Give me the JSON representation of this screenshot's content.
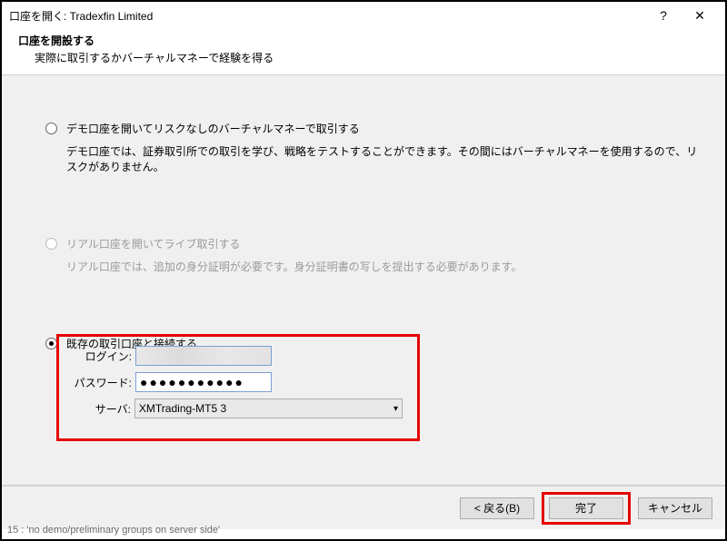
{
  "titlebar": {
    "title": "口座を開く: Tradexfin Limited",
    "help": "?",
    "close": "✕"
  },
  "subheader": {
    "title": "口座を開設する",
    "desc": "実際に取引するかバーチャルマネーで経験を得る"
  },
  "options": {
    "demo": {
      "title": "デモ口座を開いてリスクなしのバーチャルマネーで取引する",
      "desc": "デモ口座では、証券取引所での取引を学び、戦略をテストすることができます。その間にはバーチャルマネーを使用するので、リスクがありません。"
    },
    "real": {
      "title": "リアル口座を開いてライブ取引する",
      "desc": "リアル口座では、追加の身分証明が必要です。身分証明書の写しを提出する必要があります。"
    },
    "existing": {
      "title": "既存の取引口座と接続する"
    }
  },
  "form": {
    "login_label": "ログイン:",
    "login_value": "",
    "password_label": "パスワード:",
    "password_mask": "●●●●●●●●●●●",
    "server_label": "サーバ:",
    "server_value": "XMTrading-MT5 3"
  },
  "footer": {
    "back": "< 戻る(B)",
    "finish": "完了",
    "cancel": "キャンセル"
  },
  "status": "15 : 'no demo/preliminary groups on server side'"
}
